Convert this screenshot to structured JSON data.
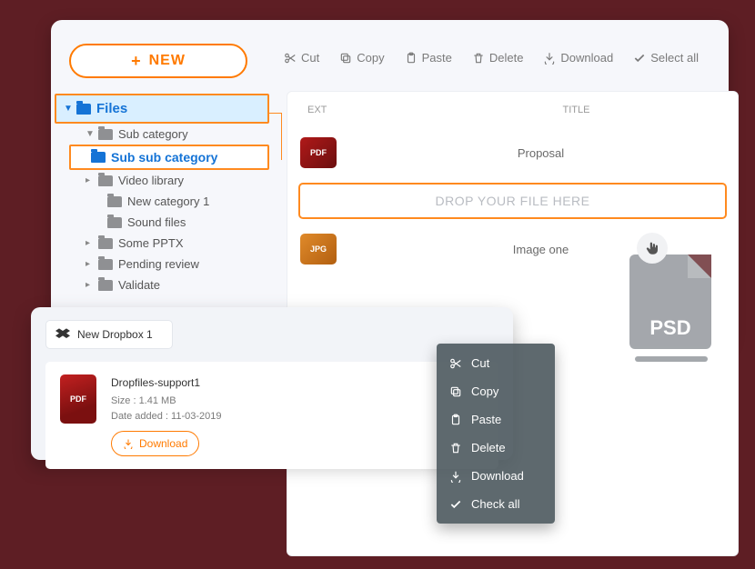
{
  "new_button_label": "NEW",
  "toolbar": {
    "cut": "Cut",
    "copy": "Copy",
    "paste": "Paste",
    "delete": "Delete",
    "download": "Download",
    "select_all": "Select all"
  },
  "tree": {
    "root": "Files",
    "items": [
      "Sub category",
      "Sub sub category",
      "Video library",
      "New category 1",
      "Sound files",
      "Some PPTX",
      "Pending review",
      "Validate"
    ]
  },
  "file_list": {
    "headers": {
      "ext": "EXT",
      "title": "TITLE"
    },
    "rows": [
      {
        "ext": "PDF",
        "title": "Proposal"
      },
      {
        "ext": "JPG",
        "title": "Image one"
      }
    ],
    "dropzone": "DROP YOUR FILE HERE"
  },
  "psd_label": "PSD",
  "dropbox_card": {
    "title": "New Dropbox 1",
    "file": {
      "name": "Dropfiles-support1",
      "ext": "PDF",
      "size_label": "Size : 1.41 MB",
      "date_label": "Date added : 11-03-2019",
      "download": "Download"
    }
  },
  "context_menu": {
    "cut": "Cut",
    "copy": "Copy",
    "paste": "Paste",
    "delete": "Delete",
    "download": "Download",
    "check_all": "Check all"
  }
}
